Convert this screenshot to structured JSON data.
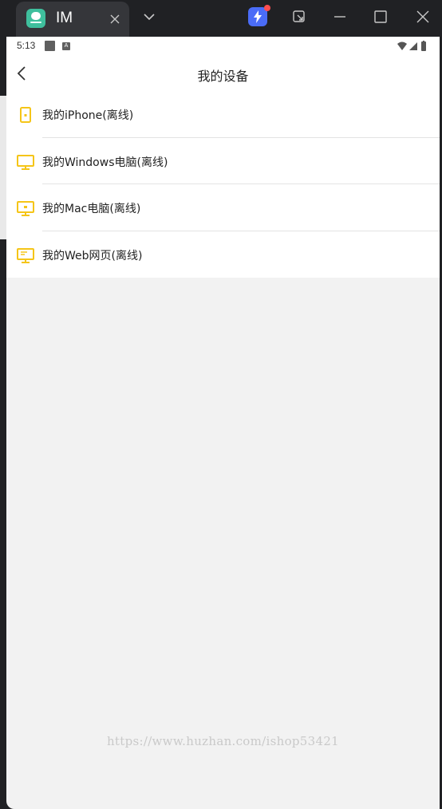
{
  "browser": {
    "tab_title": "IM",
    "accent_app_icon": "#3fbf9d",
    "extension_color": "#4a6cf7"
  },
  "status_bar": {
    "time": "5:13",
    "a_badge": "A"
  },
  "nav": {
    "title": "我的设备"
  },
  "devices": [
    {
      "label": "我的iPhone(离线)",
      "icon": "phone-icon"
    },
    {
      "label": "我的Windows电脑(离线)",
      "icon": "desktop-icon"
    },
    {
      "label": "我的Mac电脑(离线)",
      "icon": "mac-icon"
    },
    {
      "label": "我的Web网页(离线)",
      "icon": "web-icon"
    }
  ],
  "icon_color": "#f5c518",
  "watermark": "https://www.huzhan.com/ishop53421"
}
